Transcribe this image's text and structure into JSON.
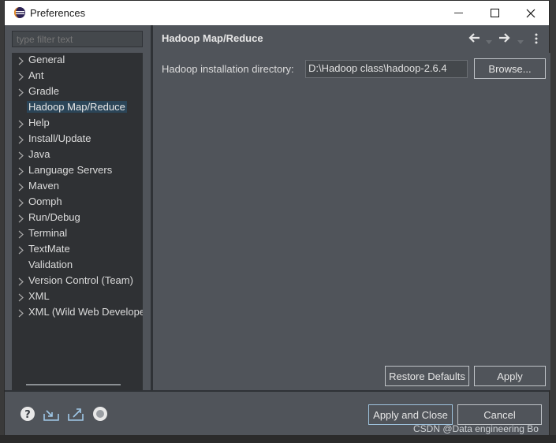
{
  "window": {
    "title": "Preferences"
  },
  "filter": {
    "placeholder": "type filter text"
  },
  "tree": {
    "items": [
      {
        "label": "General",
        "expandable": true
      },
      {
        "label": "Ant",
        "expandable": true
      },
      {
        "label": "Gradle",
        "expandable": true
      },
      {
        "label": "Hadoop Map/Reduce",
        "expandable": false,
        "selected": true
      },
      {
        "label": "Help",
        "expandable": true
      },
      {
        "label": "Install/Update",
        "expandable": true
      },
      {
        "label": "Java",
        "expandable": true
      },
      {
        "label": "Language Servers",
        "expandable": true
      },
      {
        "label": "Maven",
        "expandable": true
      },
      {
        "label": "Oomph",
        "expandable": true
      },
      {
        "label": "Run/Debug",
        "expandable": true
      },
      {
        "label": "Terminal",
        "expandable": true
      },
      {
        "label": "TextMate",
        "expandable": true
      },
      {
        "label": "Validation",
        "expandable": false
      },
      {
        "label": "Version Control (Team)",
        "expandable": true
      },
      {
        "label": "XML",
        "expandable": true
      },
      {
        "label": "XML (Wild Web Developer)",
        "expandable": true
      }
    ]
  },
  "page": {
    "title": "Hadoop Map/Reduce",
    "install_dir_label": "Hadoop installation directory:",
    "install_dir_value": "D:\\Hadoop class\\hadoop-2.6.4",
    "browse_label": "Browse..."
  },
  "buttons": {
    "restore_defaults": "Restore Defaults",
    "apply": "Apply",
    "apply_and_close": "Apply and Close",
    "cancel": "Cancel"
  },
  "colors": {
    "panel": "#50545a",
    "tree_bg": "#2f3134",
    "selection": "#2b4558",
    "accent_border": "#9fc3de"
  },
  "icons": {
    "app": "eclipse-icon",
    "back": "arrow-left-icon",
    "forward": "arrow-right-icon",
    "menu": "kebab-menu-icon",
    "help": "help-icon",
    "import": "import-icon",
    "export": "export-icon",
    "record": "record-icon"
  },
  "watermark": "CSDN @Data engineering Bo"
}
